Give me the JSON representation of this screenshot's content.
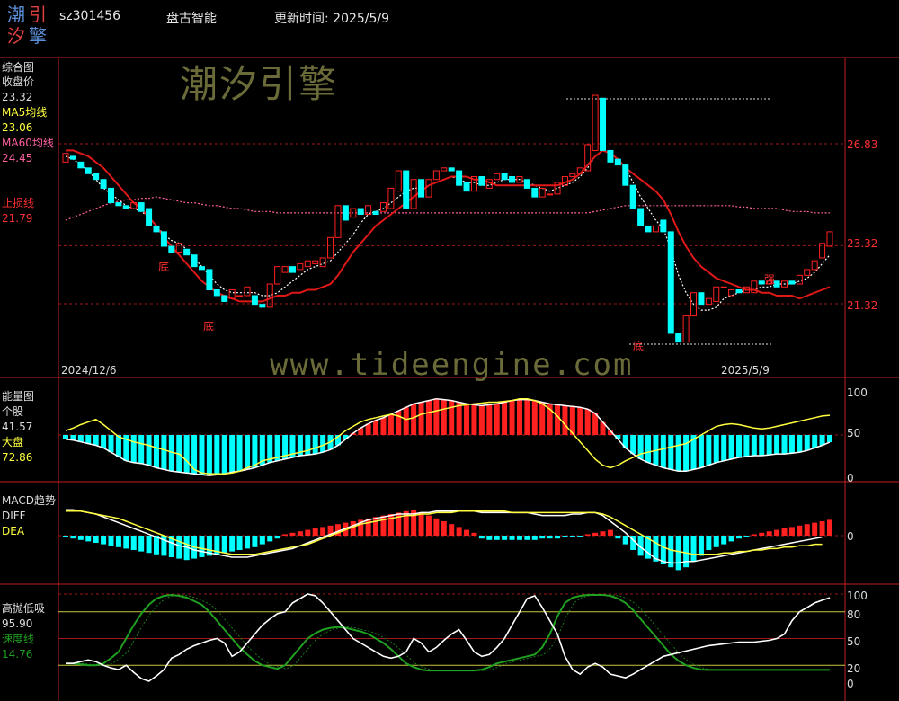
{
  "header": {
    "logo_chars": [
      "潮",
      "引",
      "汐",
      "擎"
    ],
    "stock_code": "sz301456",
    "company": "盘古智能",
    "update_label": "更新时间: 2025/5/9"
  },
  "watermark": {
    "cn": "潮汐引擎",
    "url": "www.tideengine.com"
  },
  "colors": {
    "up": "#ff2020",
    "down": "#00ffff",
    "white": "#ffffff",
    "yellow": "#ffff40",
    "red_line": "#e01818",
    "pink": "#ff60a0",
    "green": "#20a020",
    "frame": "#c02020"
  },
  "panel_main": {
    "title": "综合图",
    "lbl_close": "收盘价",
    "val_close": "23.32",
    "lbl_ma5": "MA5均线",
    "val_ma5": "23.06",
    "lbl_ma60": "MA60均线",
    "val_ma60": "24.45",
    "lbl_stop": "止损线",
    "val_stop": "21.79",
    "date_start": "2024/12/6",
    "date_end": "2025/5/9",
    "yticks": [
      "26.83",
      "23.32",
      "21.32"
    ],
    "marks": [
      "底",
      "底",
      "底",
      "强"
    ]
  },
  "panel_energy": {
    "title": "能量图",
    "lbl_stock": "个股",
    "val_stock": "41.57",
    "lbl_market": "大盘",
    "val_market": "72.86",
    "yticks": [
      "100",
      "50",
      "0"
    ]
  },
  "panel_macd": {
    "title": "MACD趋势",
    "lbl_diff": "DIFF",
    "lbl_dea": "DEA",
    "yticks": [
      "0"
    ]
  },
  "panel_gpdx": {
    "title": "高抛低吸",
    "val_main": "95.90",
    "lbl_speed": "速度线",
    "val_speed": "14.76",
    "yticks": [
      "100",
      "80",
      "50",
      "20",
      "0"
    ]
  },
  "chart_data": {
    "type": "candlestick",
    "x_start": "2024/12/6",
    "x_end": "2025/5/9",
    "price_ticks": [
      26.83,
      23.32,
      21.32
    ],
    "candles": [
      {
        "o": 26.2,
        "c": 26.5
      },
      {
        "o": 26.4,
        "c": 26.3
      },
      {
        "o": 26.2,
        "c": 26.0
      },
      {
        "o": 26.0,
        "c": 25.8
      },
      {
        "o": 25.8,
        "c": 25.6
      },
      {
        "o": 25.6,
        "c": 25.3
      },
      {
        "o": 25.3,
        "c": 24.8
      },
      {
        "o": 24.8,
        "c": 24.7
      },
      {
        "o": 24.7,
        "c": 24.6
      },
      {
        "o": 24.6,
        "c": 24.8
      },
      {
        "o": 24.8,
        "c": 24.5
      },
      {
        "o": 24.6,
        "c": 24.0
      },
      {
        "o": 24.0,
        "c": 23.8
      },
      {
        "o": 23.8,
        "c": 23.3
      },
      {
        "o": 23.3,
        "c": 23.1
      },
      {
        "o": 23.1,
        "c": 23.4
      },
      {
        "o": 23.2,
        "c": 23.0
      },
      {
        "o": 23.0,
        "c": 22.6
      },
      {
        "o": 22.6,
        "c": 22.5
      },
      {
        "o": 22.5,
        "c": 21.8
      },
      {
        "o": 21.8,
        "c": 21.6
      },
      {
        "o": 21.6,
        "c": 21.4
      },
      {
        "o": 21.5,
        "c": 21.8
      },
      {
        "o": 21.6,
        "c": 21.6
      },
      {
        "o": 21.6,
        "c": 21.9
      },
      {
        "o": 21.6,
        "c": 21.3
      },
      {
        "o": 21.3,
        "c": 21.2
      },
      {
        "o": 21.2,
        "c": 22.0
      },
      {
        "o": 22.0,
        "c": 22.6
      },
      {
        "o": 22.4,
        "c": 22.6
      },
      {
        "o": 22.6,
        "c": 22.4
      },
      {
        "o": 22.5,
        "c": 22.7
      },
      {
        "o": 22.6,
        "c": 22.8
      },
      {
        "o": 22.7,
        "c": 22.8
      },
      {
        "o": 22.6,
        "c": 22.9
      },
      {
        "o": 22.9,
        "c": 23.6
      },
      {
        "o": 23.6,
        "c": 24.7
      },
      {
        "o": 24.7,
        "c": 24.2
      },
      {
        "o": 24.3,
        "c": 24.6
      },
      {
        "o": 24.6,
        "c": 24.4
      },
      {
        "o": 24.4,
        "c": 24.7
      },
      {
        "o": 24.5,
        "c": 24.4
      },
      {
        "o": 24.5,
        "c": 24.8
      },
      {
        "o": 24.6,
        "c": 25.3
      },
      {
        "o": 25.2,
        "c": 25.9
      },
      {
        "o": 25.9,
        "c": 24.6
      },
      {
        "o": 24.6,
        "c": 25.6
      },
      {
        "o": 25.6,
        "c": 25.0
      },
      {
        "o": 25.0,
        "c": 25.6
      },
      {
        "o": 25.6,
        "c": 25.9
      },
      {
        "o": 25.9,
        "c": 26.0
      },
      {
        "o": 26.0,
        "c": 25.9
      },
      {
        "o": 25.9,
        "c": 25.4
      },
      {
        "o": 25.5,
        "c": 25.2
      },
      {
        "o": 25.2,
        "c": 25.7
      },
      {
        "o": 25.7,
        "c": 25.4
      },
      {
        "o": 25.3,
        "c": 25.6
      },
      {
        "o": 25.6,
        "c": 25.8
      },
      {
        "o": 25.8,
        "c": 25.6
      },
      {
        "o": 25.7,
        "c": 25.5
      },
      {
        "o": 25.5,
        "c": 25.7
      },
      {
        "o": 25.6,
        "c": 25.3
      },
      {
        "o": 25.3,
        "c": 25.0
      },
      {
        "o": 25.0,
        "c": 25.3
      },
      {
        "o": 25.1,
        "c": 25.1
      },
      {
        "o": 25.1,
        "c": 25.5
      },
      {
        "o": 25.4,
        "c": 25.7
      },
      {
        "o": 25.7,
        "c": 25.8
      },
      {
        "o": 25.8,
        "c": 26.0
      },
      {
        "o": 25.9,
        "c": 26.8
      },
      {
        "o": 26.6,
        "c": 28.5
      },
      {
        "o": 28.4,
        "c": 26.6
      },
      {
        "o": 26.6,
        "c": 26.2
      },
      {
        "o": 26.3,
        "c": 26.1
      },
      {
        "o": 26.1,
        "c": 25.4
      },
      {
        "o": 25.4,
        "c": 24.6
      },
      {
        "o": 24.6,
        "c": 24.0
      },
      {
        "o": 24.0,
        "c": 23.8
      },
      {
        "o": 23.8,
        "c": 24.0
      },
      {
        "o": 24.2,
        "c": 23.8
      },
      {
        "o": 23.8,
        "c": 20.3
      },
      {
        "o": 20.3,
        "c": 20.0
      },
      {
        "o": 20.0,
        "c": 20.9
      },
      {
        "o": 20.9,
        "c": 21.7
      },
      {
        "o": 21.7,
        "c": 21.3
      },
      {
        "o": 21.3,
        "c": 21.5
      },
      {
        "o": 21.4,
        "c": 21.9
      },
      {
        "o": 21.9,
        "c": 21.9
      },
      {
        "o": 21.6,
        "c": 21.8
      },
      {
        "o": 21.8,
        "c": 21.7
      },
      {
        "o": 21.7,
        "c": 21.9
      },
      {
        "o": 21.7,
        "c": 22.1
      },
      {
        "o": 22.1,
        "c": 22.0
      },
      {
        "o": 22.0,
        "c": 22.1
      },
      {
        "o": 22.1,
        "c": 21.9
      },
      {
        "o": 21.9,
        "c": 22.1
      },
      {
        "o": 22.1,
        "c": 22.0
      },
      {
        "o": 22.0,
        "c": 22.3
      },
      {
        "o": 22.3,
        "c": 22.5
      },
      {
        "o": 22.5,
        "c": 22.8
      },
      {
        "o": 22.9,
        "c": 23.4
      },
      {
        "o": 23.3,
        "c": 23.8
      }
    ],
    "ma5": [
      26.4,
      26.3,
      26.1,
      25.9,
      25.6,
      25.3,
      25.1,
      24.9,
      24.7,
      24.6,
      24.5,
      24.3,
      24.0,
      23.7,
      23.5,
      23.4,
      23.2,
      22.9,
      22.6,
      22.3,
      22.0,
      21.8,
      21.7,
      21.7,
      21.7,
      21.7,
      21.6,
      21.6,
      21.7,
      21.9,
      22.1,
      22.3,
      22.5,
      22.6,
      22.7,
      22.8,
      23.1,
      23.4,
      23.7,
      24.1,
      24.4,
      24.5,
      24.6,
      24.8,
      25.0,
      25.2,
      25.3,
      25.3,
      25.4,
      25.5,
      25.6,
      25.7,
      25.6,
      25.5,
      25.5,
      25.4,
      25.4,
      25.5,
      25.6,
      25.6,
      25.6,
      25.5,
      25.4,
      25.3,
      25.2,
      25.3,
      25.4,
      25.5,
      25.7,
      26.0,
      26.4,
      26.6,
      26.5,
      26.3,
      26.0,
      25.5,
      25.0,
      24.6,
      24.2,
      23.9,
      23.2,
      22.3,
      21.7,
      21.3,
      21.1,
      21.1,
      21.2,
      21.5,
      21.6,
      21.7,
      21.8,
      21.8,
      21.9,
      21.9,
      22.0,
      22.0,
      22.0,
      22.1,
      22.2,
      22.4,
      22.7,
      23.0
    ],
    "ma60": [
      24.2,
      24.3,
      24.4,
      24.5,
      24.6,
      24.7,
      24.8,
      24.85,
      24.9,
      24.9,
      24.95,
      24.95,
      25.0,
      24.95,
      24.9,
      24.85,
      24.8,
      24.8,
      24.75,
      24.7,
      24.7,
      24.65,
      24.6,
      24.6,
      24.55,
      24.5,
      24.5,
      24.5,
      24.45,
      24.45,
      24.45,
      24.45,
      24.45,
      24.45,
      24.45,
      24.45,
      24.45,
      24.45,
      24.45,
      24.45,
      24.45,
      24.45,
      24.45,
      24.45,
      24.45,
      24.45,
      24.45,
      24.45,
      24.45,
      24.45,
      24.45,
      24.45,
      24.45,
      24.45,
      24.45,
      24.45,
      24.45,
      24.45,
      24.45,
      24.45,
      24.45,
      24.45,
      24.45,
      24.45,
      24.45,
      24.45,
      24.45,
      24.45,
      24.45,
      24.45,
      24.5,
      24.55,
      24.6,
      24.65,
      24.7,
      24.7,
      24.7,
      24.7,
      24.7,
      24.7,
      24.7,
      24.7,
      24.7,
      24.7,
      24.7,
      24.7,
      24.7,
      24.7,
      24.7,
      24.65,
      24.65,
      24.6,
      24.6,
      24.6,
      24.6,
      24.55,
      24.5,
      24.5,
      24.5,
      24.45,
      24.45,
      24.45
    ],
    "stop_line": [
      26.6,
      26.6,
      26.5,
      26.4,
      26.2,
      26.0,
      25.7,
      25.4,
      25.1,
      24.8,
      24.6,
      24.3,
      24.0,
      23.6,
      23.3,
      23.0,
      22.7,
      22.4,
      22.1,
      21.9,
      21.7,
      21.6,
      21.5,
      21.4,
      21.4,
      21.4,
      21.4,
      21.5,
      21.6,
      21.6,
      21.7,
      21.7,
      21.8,
      21.8,
      21.9,
      22.0,
      22.3,
      22.7,
      23.1,
      23.4,
      23.7,
      24.0,
      24.2,
      24.4,
      24.6,
      24.8,
      25.0,
      25.2,
      25.4,
      25.5,
      25.6,
      25.7,
      25.7,
      25.7,
      25.6,
      25.6,
      25.5,
      25.4,
      25.4,
      25.4,
      25.4,
      25.4,
      25.4,
      25.4,
      25.4,
      25.4,
      25.5,
      25.6,
      25.8,
      26.1,
      26.4,
      26.6,
      26.5,
      26.3,
      26.0,
      25.8,
      25.6,
      25.4,
      25.2,
      24.9,
      24.4,
      23.8,
      23.3,
      22.9,
      22.6,
      22.4,
      22.2,
      22.1,
      22.0,
      21.9,
      21.8,
      21.8,
      21.7,
      21.7,
      21.6,
      21.6,
      21.6,
      21.5,
      21.6,
      21.7,
      21.8,
      21.9
    ],
    "energy_stock": [
      45,
      44,
      42,
      40,
      38,
      35,
      30,
      25,
      20,
      18,
      17,
      15,
      12,
      10,
      8,
      7,
      6,
      5,
      4,
      3,
      4,
      5,
      7,
      8,
      10,
      12,
      15,
      18,
      20,
      22,
      24,
      26,
      27,
      28,
      30,
      33,
      38,
      45,
      52,
      58,
      63,
      67,
      70,
      74,
      78,
      82,
      86,
      88,
      90,
      92,
      91,
      90,
      88,
      86,
      85,
      84,
      85,
      86,
      88,
      90,
      91,
      91,
      90,
      88,
      86,
      85,
      84,
      83,
      82,
      80,
      75,
      65,
      55,
      45,
      35,
      28,
      22,
      18,
      15,
      12,
      10,
      8,
      8,
      10,
      12,
      15,
      18,
      20,
      22,
      24,
      25,
      26,
      26,
      27,
      28,
      28,
      29,
      30,
      32,
      35,
      38,
      41.57
    ],
    "energy_market": [
      55,
      58,
      62,
      65,
      68,
      62,
      55,
      48,
      45,
      42,
      40,
      38,
      35,
      33,
      30,
      28,
      20,
      10,
      6,
      5,
      5,
      5,
      6,
      8,
      12,
      15,
      20,
      22,
      24,
      26,
      28,
      30,
      32,
      35,
      38,
      42,
      48,
      55,
      60,
      65,
      68,
      70,
      72,
      74,
      72,
      68,
      70,
      74,
      76,
      78,
      80,
      82,
      84,
      85,
      86,
      87,
      88,
      88,
      89,
      90,
      92,
      92,
      90,
      86,
      80,
      72,
      62,
      52,
      42,
      32,
      22,
      15,
      12,
      15,
      20,
      24,
      28,
      30,
      32,
      34,
      36,
      38,
      40,
      45,
      50,
      55,
      60,
      62,
      63,
      62,
      60,
      58,
      57,
      58,
      60,
      62,
      64,
      66,
      68,
      70,
      72,
      72.86
    ],
    "macd_hist": [
      -1,
      -2,
      -3,
      -4,
      -5,
      -6,
      -7,
      -8,
      -9,
      -10,
      -11,
      -12,
      -13,
      -14,
      -15,
      -16,
      -17,
      -16,
      -15,
      -14,
      -13,
      -12,
      -11,
      -10,
      -9,
      -8,
      -6,
      -4,
      -2,
      1,
      2,
      3,
      4,
      5,
      6,
      7,
      8,
      9,
      10,
      11,
      12,
      13,
      14,
      15,
      16,
      17,
      18,
      16,
      14,
      12,
      10,
      8,
      6,
      4,
      2,
      -2,
      -3,
      -3,
      -3,
      -3,
      -3,
      -3,
      -3,
      -2,
      -2,
      -2,
      -1,
      -1,
      -1,
      1,
      2,
      3,
      4,
      -2,
      -6,
      -10,
      -14,
      -16,
      -18,
      -20,
      -22,
      -24,
      -22,
      -18,
      -14,
      -10,
      -8,
      -6,
      -4,
      -2,
      -1,
      1,
      2,
      3,
      4,
      5,
      6,
      7,
      8,
      9,
      10,
      11
    ],
    "macd_diff": [
      18,
      18,
      17,
      16,
      15,
      13,
      11,
      9,
      7,
      5,
      3,
      1,
      -1,
      -3,
      -5,
      -7,
      -8,
      -10,
      -11,
      -12,
      -13,
      -14,
      -15,
      -15,
      -15,
      -14,
      -13,
      -12,
      -11,
      -10,
      -9,
      -7,
      -5,
      -3,
      -1,
      1,
      3,
      5,
      7,
      9,
      11,
      12,
      13,
      14,
      15,
      15,
      15,
      16,
      16,
      17,
      17,
      17,
      17,
      17,
      17,
      16,
      16,
      16,
      16,
      16,
      16,
      16,
      15,
      14,
      14,
      14,
      14,
      15,
      15,
      16,
      16,
      14,
      10,
      6,
      2,
      -3,
      -8,
      -12,
      -16,
      -18,
      -19,
      -19,
      -18,
      -18,
      -17,
      -16,
      -15,
      -14,
      -13,
      -12,
      -11,
      -10,
      -9,
      -8,
      -7,
      -6,
      -5,
      -4,
      -3,
      -2,
      -1
    ],
    "macd_dea": [
      17,
      17,
      17,
      16,
      15,
      14,
      13,
      12,
      10,
      8,
      6,
      4,
      2,
      0,
      -2,
      -4,
      -6,
      -8,
      -9,
      -10,
      -11,
      -12,
      -13,
      -13,
      -13,
      -13,
      -12,
      -11,
      -10,
      -9,
      -8,
      -7,
      -6,
      -4,
      -2,
      0,
      2,
      4,
      6,
      8,
      9,
      10,
      11,
      12,
      13,
      14,
      14,
      15,
      15,
      16,
      16,
      16,
      17,
      17,
      17,
      17,
      17,
      17,
      17,
      16,
      16,
      16,
      16,
      16,
      16,
      16,
      16,
      16,
      16,
      16,
      16,
      15,
      13,
      10,
      7,
      4,
      1,
      -2,
      -5,
      -8,
      -10,
      -11,
      -12,
      -13,
      -13,
      -13,
      -13,
      -12,
      -12,
      -11,
      -11,
      -10,
      -10,
      -9,
      -9,
      -8,
      -8,
      -7,
      -7,
      -6,
      -6
    ],
    "gp_main": [
      22,
      22,
      24,
      26,
      24,
      20,
      17,
      15,
      20,
      12,
      5,
      2,
      8,
      15,
      28,
      32,
      38,
      42,
      45,
      48,
      50,
      45,
      30,
      35,
      45,
      55,
      65,
      72,
      78,
      80,
      90,
      95,
      100,
      98,
      90,
      80,
      70,
      60,
      50,
      45,
      40,
      35,
      30,
      28,
      30,
      35,
      50,
      45,
      35,
      40,
      48,
      55,
      60,
      48,
      35,
      30,
      32,
      40,
      50,
      65,
      80,
      95,
      98,
      85,
      70,
      55,
      30,
      15,
      10,
      18,
      22,
      18,
      10,
      8,
      6,
      10,
      15,
      20,
      25,
      30,
      32,
      34,
      36,
      38,
      40,
      42,
      43,
      44,
      45,
      46,
      46,
      46,
      47,
      48,
      50,
      55,
      70,
      80,
      85,
      90,
      93,
      95.9
    ],
    "gp_speed": [
      22,
      22,
      21,
      20,
      20,
      22,
      28,
      35,
      50,
      65,
      78,
      88,
      95,
      98,
      99,
      98,
      96,
      92,
      88,
      80,
      70,
      60,
      50,
      40,
      32,
      25,
      20,
      18,
      16,
      20,
      30,
      40,
      50,
      56,
      60,
      62,
      63,
      62,
      60,
      58,
      55,
      50,
      45,
      38,
      30,
      22,
      18,
      15,
      14,
      14,
      14,
      14,
      14,
      14,
      14,
      15,
      18,
      22,
      24,
      26,
      28,
      30,
      32,
      40,
      55,
      75,
      90,
      96,
      98,
      99,
      99,
      99,
      98,
      95,
      90,
      82,
      72,
      62,
      52,
      42,
      32,
      25,
      20,
      17,
      15,
      14.76,
      14.76,
      14.76,
      14.76,
      14.76,
      14.76,
      14.76,
      14.76,
      14.76,
      14.76,
      14.76,
      14.76,
      14.76,
      14.76,
      14.76,
      14.76,
      14.76
    ]
  }
}
